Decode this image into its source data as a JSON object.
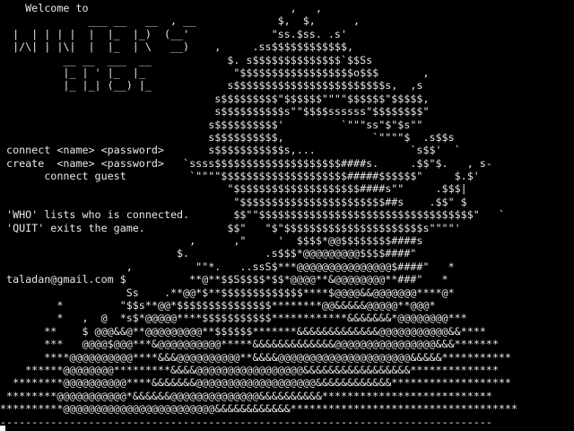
{
  "terminal": {
    "background": "#000000",
    "foreground": "#e8e8e8",
    "lines": [
      "    Welcome to                                ,   ,",
      "              ___ __   __  , __             $,  $,      ,",
      "  |  | | | |  |  |_  |_)  (__'             \"ss.$ss. .s'",
      "  |/\\| | |\\|  |  |_  | \\   __)    ,     .ss$$$$$$$$$$$$,",
      "          __ __  ___  __            $. s$$$$$$$$$$$$$$`$$Ss",
      "          |_ | ' |_  |_              \"$$$$$$$$$$$$$$$$$$o$$$       ,",
      "          |_ |_| (__) |_            s$$$$$$$$$$$$$$$$$$$$$$$$s,  ,s",
      "                                  s$$$$$$$$$\"$$$$$$\"\"\"\"$$$$$$\"$$$$$,",
      "                                  s$$$$$$$$$$s\"\"$$$$ssssss\"$$$$$$$$\"",
      "                                 s$$$$$$$$$$'         `\"\"\"ss\"$\"$s\"\"",
      "                                 s$$$$$$$$$$,              `\"\"\"\"$  .s$$s",
      " connect <name> <password>       s$$$$$$$$$$$s,...               `s$$'  `",
      " create  <name> <password>   `ssss$$$$$$$$$$$$$$$$$$$$####s.     .$$\"$.   , s-",
      "       connect guest          `\"\"\"\"$$$$$$$$$$$$$$$$$$$$#####$$$$$$\"     $.$'",
      "                                    \"$$$$$$$$$$$$$$$$$$$$####s\"\"     .$$$|",
      "                                     \"$$$$$$$$$$$$$$$$$$$$$$$##s    .$$\" $",
      " 'WHO' lists who is connected.       $$\"\"$$$$$$$$$$$$$$$$$$$$$$$$$$$$$$$$$$\"   `",
      " 'QUIT' exits the game.             $$\"   \"$\"$$$$$$$$$$$$$$$$$$$$$$s\"\"\"\"'",
      "                              ,      ,\"     '  $$$$*@@$$$$$$$$####s",
      "                            $.            .s$$$*@@@@@@@@@$$$$####\"",
      "                    ,          \"\"*.   ..ssS$***@@@@@@@@@@@@@@@$####\"   *",
      " taladan@gmail.com $          **@**$$S$$$$*$$*@@@@**&@@@@@@@@**###\"   *",
      "                    Ss    .**@@*$**$$$$$$$$$$$$$****$@@@@&&@@@@@@@****@*",
      "         *         \"$$s**@@*$$$$$$$$$$$$$$$********@@&&&&&@@@@@**@@@*",
      "         *   ,  @  *s$*@@@@@****$$$$$$$$$$$************&&&&&&&*@@@@@@@@***",
      "       **    $ @@@&&@**@@@@@@@@@**$$$$$$*******&&&&&&&&&&&&&@@@@@@@@@@@&&****",
      "       ***   @@@@$@@@***&@@@@@@@@@@*****&&&&&&&&&&&&&@@@@@@@@@@@@@@@@&&&*******",
      "       ****@@@@@@@@@@****&&&@@@@@@@@@@**&&&&@@@@@@@@@@@@@@@@@@@@@&&&&&***********",
      "    ******@@@@@@@@*********&&&&@@@@@@@@@@@@@@@@@&&&&&&&&&&&&&&&&&**************",
      "  ********@@@@@@@@@@****&&&&&&&@@@@@@@@@@@@@@@@@@@&&&&&&&&&&&&*******************",
      " ********@@@@@@@@@@@*&&&&&&@@@@@@@@@@@@@@&&&&&&&&&&***************************",
      "**********@@@@@@@@@@@@@@@@@@@@@@@@&&&&&&&&&&&&************************************",
      "------------------------------------------------------------------------------"
    ]
  }
}
